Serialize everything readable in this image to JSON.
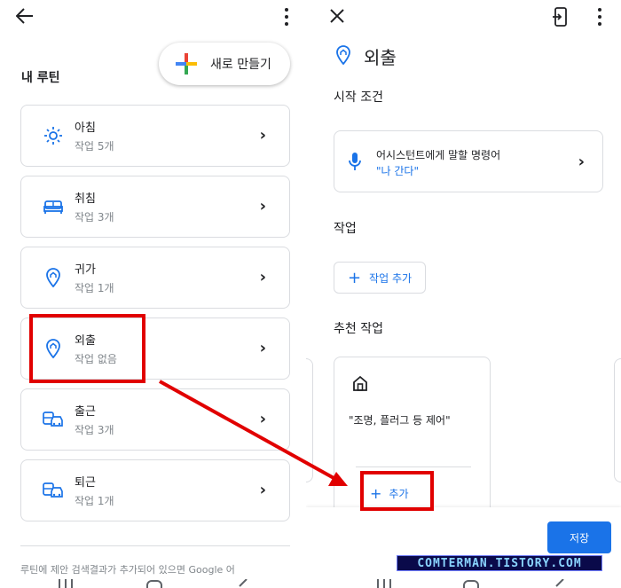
{
  "left": {
    "section_title": "내 루틴",
    "new_button_label": "새로 만들기",
    "routines": [
      {
        "name": "아침",
        "sub": "작업 5개",
        "icon": "sun-icon"
      },
      {
        "name": "취침",
        "sub": "작업 3개",
        "icon": "bed-icon"
      },
      {
        "name": "귀가",
        "sub": "작업 1개",
        "icon": "location-home-icon"
      },
      {
        "name": "외출",
        "sub": "작업 없음",
        "icon": "location-home-icon"
      },
      {
        "name": "출근",
        "sub": "작업 3개",
        "icon": "commute-icon"
      },
      {
        "name": "퇴근",
        "sub": "작업 1개",
        "icon": "commute-icon"
      }
    ],
    "footer": "루틴에 제안 검색결과가 추가되어 있으면 Google 어"
  },
  "right": {
    "title": "외출",
    "start_condition_label": "시작 조건",
    "condition_line1": "어시스턴트에게 말할 명령어",
    "condition_line2": "\"나 간다\"",
    "tasks_label": "작업",
    "add_task_label": "작업 추가",
    "suggested_label": "추천 작업",
    "suggestion_text": "\"조명, 플러그 등 제어\"",
    "suggestion_add": "추가",
    "save_label": "저장"
  },
  "watermark": "COMTERMAN.TISTORY.COM",
  "colors": {
    "accent": "#1a73e8",
    "highlight": "#e10000"
  }
}
